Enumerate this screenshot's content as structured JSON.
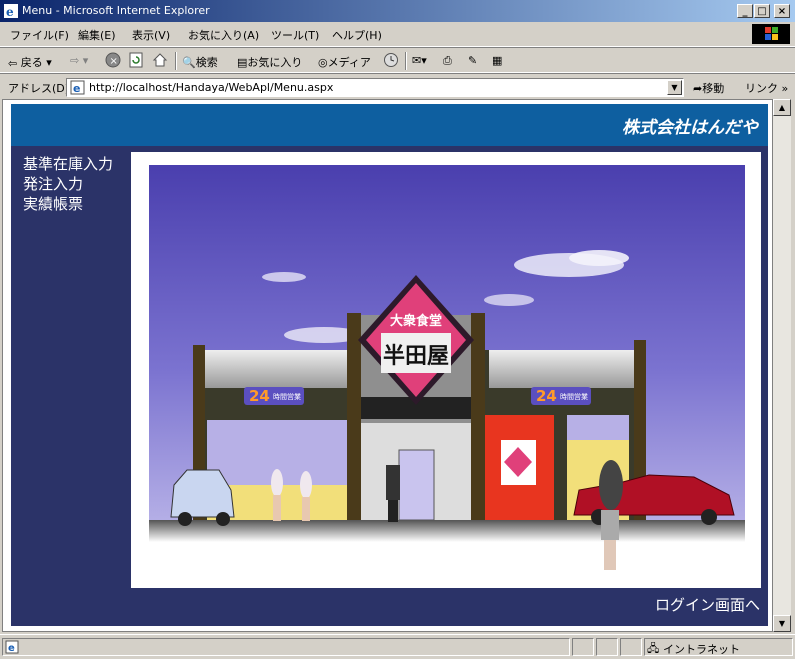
{
  "window": {
    "title": "Menu - Microsoft Internet Explorer",
    "minimize": "_",
    "maximize": "□",
    "close": "×"
  },
  "menubar": {
    "items": [
      "ファイル(F)",
      "編集(E)",
      "表示(V)",
      "お気に入り(A)",
      "ツール(T)",
      "ヘルプ(H)"
    ]
  },
  "toolbar": {
    "back": "戻る",
    "search": "検索",
    "favorites": "お気に入り",
    "media": "メディア"
  },
  "addressbar": {
    "label": "アドレス(D)",
    "url": "http://localhost/Handaya/WebApl/Menu.aspx",
    "go": "移動",
    "links": "リンク »"
  },
  "page": {
    "company": "株式会社はんだや",
    "nav": [
      "基準在庫入力",
      "発注入力",
      "実績帳票"
    ],
    "login_link": "ログイン画面へ",
    "store_sign_top": "大衆食堂",
    "store_sign_main": "半田屋",
    "badge_num": "24",
    "badge_text": "時間営業"
  },
  "statusbar": {
    "zone": "イントラネット"
  }
}
